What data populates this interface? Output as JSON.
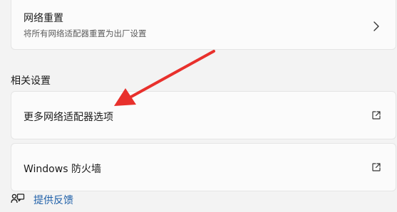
{
  "network_reset": {
    "title": "网络重置",
    "subtitle": "将所有网络适配器重置为出厂设置",
    "icon": "chevron-right-icon"
  },
  "related_settings": {
    "heading": "相关设置",
    "items": [
      {
        "label": "更多网络适配器选项",
        "icon": "external-link-icon"
      },
      {
        "label": "Windows 防火墙",
        "icon": "external-link-icon"
      }
    ]
  },
  "feedback": {
    "label": "提供反馈",
    "icon": "feedback-icon"
  },
  "colors": {
    "annotation_arrow": "#e8302c",
    "link": "#1e5fa8",
    "card_background": "#fbfbfb",
    "page_background": "#f3f3f3"
  }
}
